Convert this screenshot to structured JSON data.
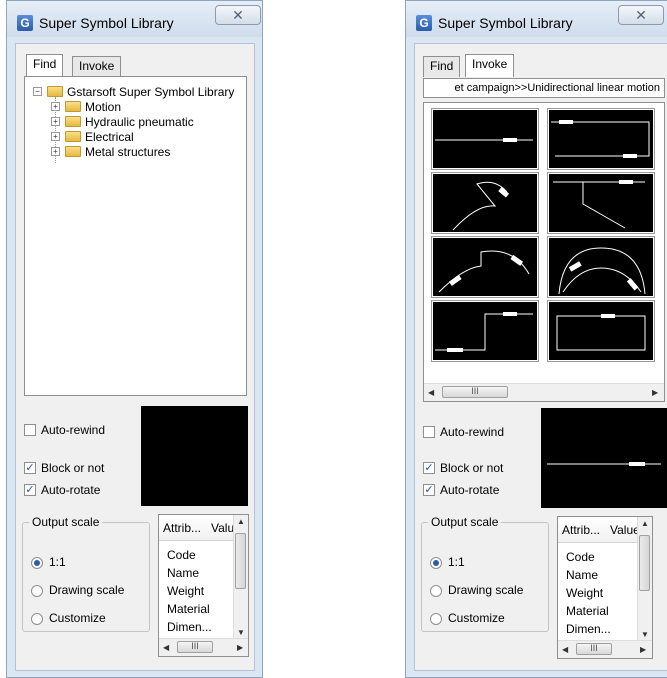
{
  "window": {
    "title": "Super Symbol Library",
    "close_glyph": "✕"
  },
  "tabs": {
    "find": "Find",
    "invoke": "Invoke"
  },
  "tree": {
    "root": "Gstarsoft Super Symbol Library",
    "children": [
      "Motion",
      "Hydraulic pneumatic",
      "Electrical",
      "Metal structures"
    ]
  },
  "invoke": {
    "breadcrumb": "et campaign>>Unidirectional linear motion",
    "thumbnails": [
      "symbol-1",
      "symbol-2",
      "symbol-3",
      "symbol-4",
      "symbol-5",
      "symbol-6",
      "symbol-7",
      "symbol-8"
    ]
  },
  "options": {
    "auto_rewind": {
      "label": "Auto-rewind",
      "checked": false
    },
    "block_or_not": {
      "label": "Block or not",
      "checked": true
    },
    "auto_rotate": {
      "label": "Auto-rotate",
      "checked": true
    }
  },
  "output_scale": {
    "label": "Output scale",
    "options": [
      "1:1",
      "Drawing scale",
      "Customize"
    ],
    "selected": "1:1"
  },
  "attributes": {
    "headers": [
      "Attrib...",
      "Value"
    ],
    "items": [
      "Code",
      "Name",
      "Weight",
      "Material",
      "Dimen..."
    ]
  },
  "scroll_glyph": "III",
  "colors": {
    "title_bg": "#dbe6f3",
    "client_bg": "#f0f0f0",
    "preview_bg": "#000000",
    "accent": "#2a5ca8"
  }
}
